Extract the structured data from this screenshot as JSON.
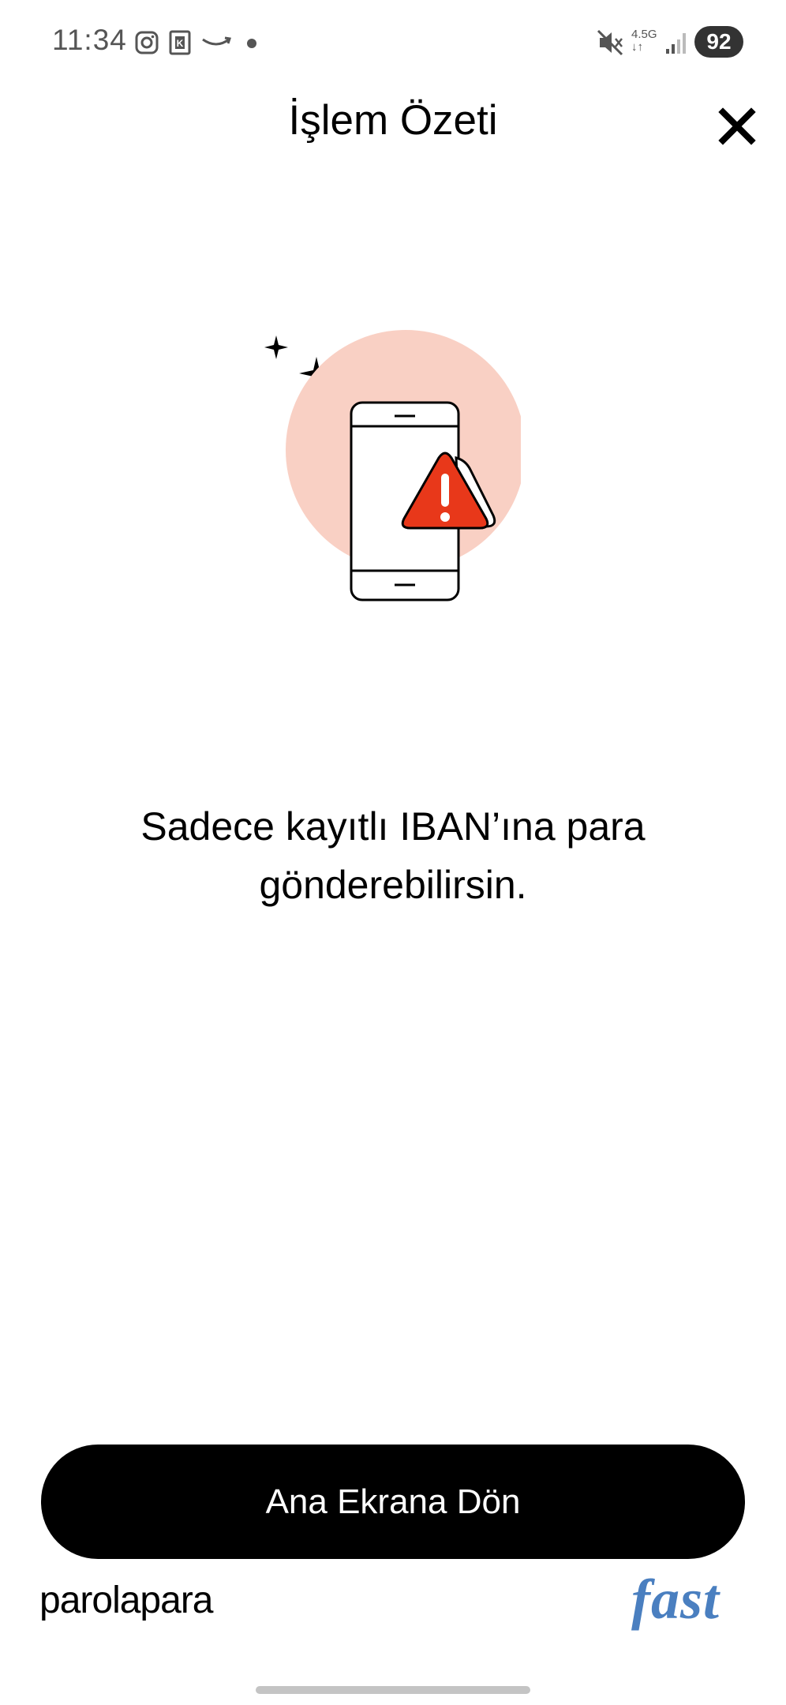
{
  "status_bar": {
    "time": "11:34",
    "network": "4.5G",
    "battery": "92",
    "icons": [
      "instagram-icon",
      "k-app-icon",
      "amazon-icon",
      "notification-dot-icon",
      "mute-icon",
      "signal-icon"
    ]
  },
  "header": {
    "title": "İşlem Özeti",
    "close_icon": "close-icon"
  },
  "illustration": {
    "name": "phone-warning-illustration",
    "circle_color": "#f9d0c4",
    "warning_color": "#e8381a"
  },
  "message": {
    "line1": "Sadece kayıtlı IBAN’ına para",
    "line2": "gönderebilirsin."
  },
  "primary_button": {
    "label": "Ana Ekrana Dön"
  },
  "footer": {
    "brand_logo": "parolapara",
    "fast_logo": "fast"
  },
  "colors": {
    "accent": "#000000",
    "warning": "#e8381a",
    "circle": "#f9d0c4",
    "fast_blue": "#4a7fc0"
  }
}
